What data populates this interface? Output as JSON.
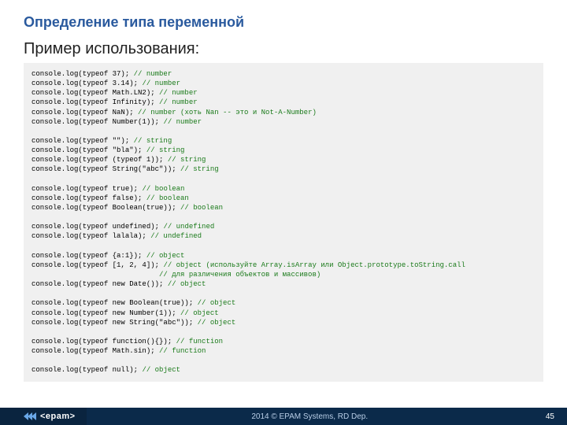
{
  "title": "Определение типа переменной",
  "subtitle": "Пример использования:",
  "code": [
    {
      "t": "console.log(typeof 37); ",
      "c": "// number"
    },
    {
      "t": "console.log(typeof 3.14); ",
      "c": "// number"
    },
    {
      "t": "console.log(typeof Math.LN2); ",
      "c": "// number"
    },
    {
      "t": "console.log(typeof Infinity); ",
      "c": "// number"
    },
    {
      "t": "console.log(typeof NaN); ",
      "c": "// number (хоть Nan -- это и Not-A-Number)"
    },
    {
      "t": "console.log(typeof Number(1)); ",
      "c": "// number"
    },
    {
      "t": "",
      "c": ""
    },
    {
      "t": "console.log(typeof \"\"); ",
      "c": "// string"
    },
    {
      "t": "console.log(typeof \"bla\"); ",
      "c": "// string"
    },
    {
      "t": "console.log(typeof (typeof 1)); ",
      "c": "// string"
    },
    {
      "t": "console.log(typeof String(\"abc\")); ",
      "c": "// string"
    },
    {
      "t": "",
      "c": ""
    },
    {
      "t": "console.log(typeof true); ",
      "c": "// boolean"
    },
    {
      "t": "console.log(typeof false); ",
      "c": "// boolean"
    },
    {
      "t": "console.log(typeof Boolean(true)); ",
      "c": "// boolean"
    },
    {
      "t": "",
      "c": ""
    },
    {
      "t": "console.log(typeof undefined); ",
      "c": "// undefined"
    },
    {
      "t": "console.log(typeof lalala); ",
      "c": "// undefined"
    },
    {
      "t": "",
      "c": ""
    },
    {
      "t": "console.log(typeof {a:1}); ",
      "c": "// object"
    },
    {
      "t": "console.log(typeof [1, 2, 4]); ",
      "c": "// object (используйте Array.isArray или Object.prototype.toString.call"
    },
    {
      "t": "                              ",
      "c": "// для различения объектов и массивов)"
    },
    {
      "t": "console.log(typeof new Date()); ",
      "c": "// object"
    },
    {
      "t": "",
      "c": ""
    },
    {
      "t": "console.log(typeof new Boolean(true)); ",
      "c": "// object"
    },
    {
      "t": "console.log(typeof new Number(1)); ",
      "c": "// object"
    },
    {
      "t": "console.log(typeof new String(\"abc\")); ",
      "c": "// object"
    },
    {
      "t": "",
      "c": ""
    },
    {
      "t": "console.log(typeof function(){}); ",
      "c": "// function"
    },
    {
      "t": "console.log(typeof Math.sin); ",
      "c": "// function"
    },
    {
      "t": "",
      "c": ""
    },
    {
      "t": "console.log(typeof null); ",
      "c": "// object"
    }
  ],
  "footer": {
    "logo_text": "<epam>",
    "text": "2014 © EPAM Systems, RD Dep.",
    "page": "45"
  }
}
